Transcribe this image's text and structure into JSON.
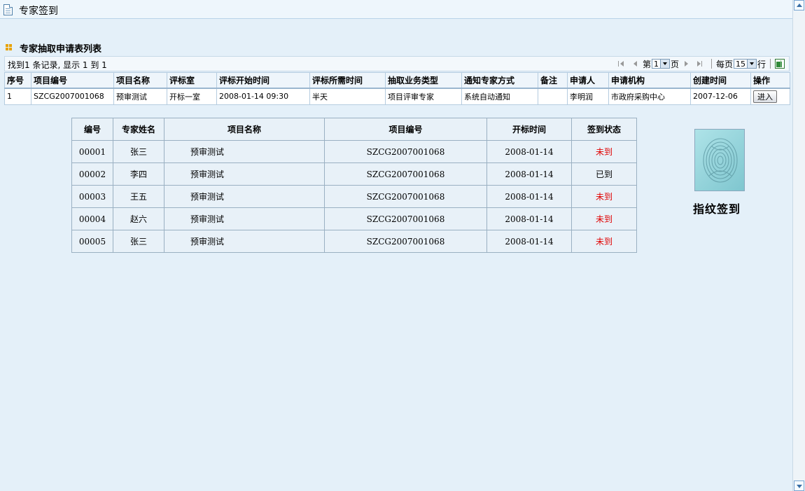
{
  "titlebar": {
    "title": "专家签到"
  },
  "section": {
    "title": "专家抽取申请表列表"
  },
  "toolbar": {
    "found_text": "找到1 条记录, 显示 1 到 1",
    "page_prefix": "第",
    "page_value": "1",
    "page_suffix": "页",
    "per_page_prefix": "每页",
    "per_page_value": "15",
    "per_page_suffix": "行"
  },
  "list": {
    "headers": [
      "序号",
      "项目编号",
      "项目名称",
      "评标室",
      "评标开始时间",
      "评标所需时间",
      "抽取业务类型",
      "通知专家方式",
      "备注",
      "申请人",
      "申请机构",
      "创建时间",
      "操作"
    ],
    "rows": [
      {
        "no": "1",
        "project_code": "SZCG2007001068",
        "project_name": "预审测试",
        "room": "开标一室",
        "start_time": "2008-01-14 09:30",
        "duration": "半天",
        "business_type": "项目评审专家",
        "notify_method": "系统自动通知",
        "remark": "",
        "applicant": "李明润",
        "org": "市政府采购中心",
        "created": "2007-12-06",
        "action_label": "进入"
      }
    ]
  },
  "signin": {
    "headers": [
      "编号",
      "专家姓名",
      "项目名称",
      "项目编号",
      "开标时间",
      "签到状态"
    ],
    "rows": [
      {
        "id": "00001",
        "name": "张三",
        "project": "预审测试",
        "code": "SZCG2007001068",
        "time": "2008-01-14",
        "status": "未到"
      },
      {
        "id": "00002",
        "name": "李四",
        "project": "预审测试",
        "code": "SZCG2007001068",
        "time": "2008-01-14",
        "status": "已到"
      },
      {
        "id": "00003",
        "name": "王五",
        "project": "预审测试",
        "code": "SZCG2007001068",
        "time": "2008-01-14",
        "status": "未到"
      },
      {
        "id": "00004",
        "name": "赵六",
        "project": "预审测试",
        "code": "SZCG2007001068",
        "time": "2008-01-14",
        "status": "未到"
      },
      {
        "id": "00005",
        "name": "张三",
        "project": "预审测试",
        "code": "SZCG2007001068",
        "time": "2008-01-14",
        "status": "未到"
      }
    ]
  },
  "fingerprint": {
    "label": "指纹签到",
    "icon": "fingerprint-icon"
  },
  "colors": {
    "background": "#e4f0f9",
    "absent": "#e00000",
    "header_bg": "#eef5fb"
  }
}
